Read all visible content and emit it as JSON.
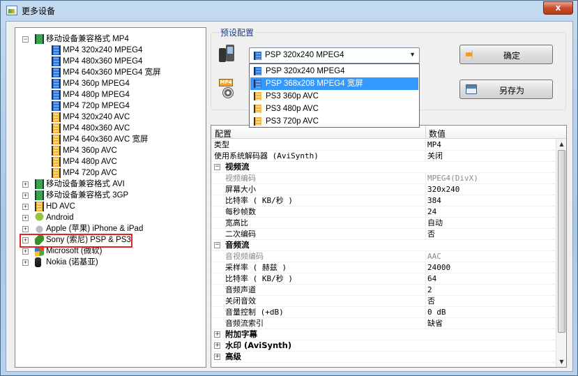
{
  "window": {
    "title": "更多设备",
    "close_label": "x"
  },
  "tree": {
    "items": [
      {
        "label": "移动设备兼容格式 MP4",
        "level": 0,
        "expander": "−",
        "icon": "film-green-icon"
      },
      {
        "label": "MP4 320x240 MPEG4",
        "level": 1,
        "icon": "film-blue-icon"
      },
      {
        "label": "MP4 480x360 MPEG4",
        "level": 1,
        "icon": "film-blue-icon"
      },
      {
        "label": "MP4 640x360 MPEG4 宽屏",
        "level": 1,
        "icon": "film-blue-icon"
      },
      {
        "label": "MP4 360p MPEG4",
        "level": 1,
        "icon": "film-blue-icon"
      },
      {
        "label": "MP4 480p MPEG4",
        "level": 1,
        "icon": "film-blue-icon"
      },
      {
        "label": "MP4 720p MPEG4",
        "level": 1,
        "icon": "film-blue-icon"
      },
      {
        "label": "MP4 320x240 AVC",
        "level": 1,
        "icon": "film-orange-icon"
      },
      {
        "label": "MP4 480x360 AVC",
        "level": 1,
        "icon": "film-orange-icon"
      },
      {
        "label": "MP4 640x360 AVC 宽屏",
        "level": 1,
        "icon": "film-orange-icon"
      },
      {
        "label": "MP4 360p AVC",
        "level": 1,
        "icon": "film-orange-icon"
      },
      {
        "label": "MP4 480p AVC",
        "level": 1,
        "icon": "film-orange-icon"
      },
      {
        "label": "MP4 720p AVC",
        "level": 1,
        "icon": "film-orange-icon"
      },
      {
        "label": "移动设备兼容格式 AVI",
        "level": 0,
        "expander": "+",
        "icon": "film-green-icon"
      },
      {
        "label": "移动设备兼容格式 3GP",
        "level": 0,
        "expander": "+",
        "icon": "film-green-icon"
      },
      {
        "label": "HD AVC",
        "level": 0,
        "expander": "+",
        "icon": "film-orange-icon"
      },
      {
        "label": "Android",
        "level": 0,
        "expander": "+",
        "icon": "android-icon"
      },
      {
        "label": "Apple (苹果) iPhone & iPad",
        "level": 0,
        "expander": "+",
        "icon": "apple-icon"
      },
      {
        "label": "Sony (索尼) PSP & PS3",
        "level": 0,
        "expander": "+",
        "icon": "sony-psp-icon"
      },
      {
        "label": "Microsoft (微软)",
        "level": 0,
        "expander": "+",
        "icon": "microsoft-icon"
      },
      {
        "label": "Nokia (诺基亚)",
        "level": 0,
        "expander": "+",
        "icon": "nokia-phone-icon"
      }
    ]
  },
  "preset": {
    "group_title": "预设配置",
    "selected": "PSP 320x240 MPEG4",
    "options": [
      {
        "label": "PSP 320x240 MPEG4",
        "icon": "film-blue-icon",
        "selected": false
      },
      {
        "label": "PSP 368x208 MPEG4 宽屏",
        "icon": "film-blue-icon",
        "selected": true
      },
      {
        "label": "PS3 360p AVC",
        "icon": "film-orange-icon",
        "selected": false
      },
      {
        "label": "PS3 480p AVC",
        "icon": "film-orange-icon",
        "selected": false
      },
      {
        "label": "PS3 720p AVC",
        "icon": "film-orange-icon",
        "selected": false
      }
    ],
    "ok_label": "确定",
    "save_as_label": "另存为",
    "mp4_badge": "MP4"
  },
  "grid": {
    "col_name": "配置",
    "col_value": "数值",
    "rows": [
      {
        "kind": "prop",
        "name": "类型",
        "value": "MP4"
      },
      {
        "kind": "prop",
        "name": "使用系统解码器 (AviSynth)",
        "value": "关闭"
      },
      {
        "kind": "cat",
        "name": "视频流",
        "exp": "−"
      },
      {
        "kind": "prop",
        "name": "视频编码",
        "value": "MPEG4(DivX)",
        "disabled": true,
        "indent": true
      },
      {
        "kind": "prop",
        "name": "屏幕大小",
        "value": "320x240",
        "indent": true
      },
      {
        "kind": "prop",
        "name": "比特率 ( KB/秒 )",
        "value": "384",
        "indent": true
      },
      {
        "kind": "prop",
        "name": "每秒帧数",
        "value": "24",
        "indent": true
      },
      {
        "kind": "prop",
        "name": "宽高比",
        "value": "自动",
        "indent": true
      },
      {
        "kind": "prop",
        "name": "二次编码",
        "value": "否",
        "indent": true
      },
      {
        "kind": "cat",
        "name": "音频流",
        "exp": "−"
      },
      {
        "kind": "prop",
        "name": "音视频编码",
        "value": "AAC",
        "disabled": true,
        "indent": true
      },
      {
        "kind": "prop",
        "name": "采样率 ( 赫兹 )",
        "value": "24000",
        "indent": true
      },
      {
        "kind": "prop",
        "name": "比特率 ( KB/秒 )",
        "value": "64",
        "indent": true
      },
      {
        "kind": "prop",
        "name": "音频声道",
        "value": "2",
        "indent": true
      },
      {
        "kind": "prop",
        "name": "关闭音效",
        "value": "否",
        "indent": true
      },
      {
        "kind": "prop",
        "name": "音量控制 (+dB)",
        "value": "0 dB",
        "indent": true
      },
      {
        "kind": "prop",
        "name": "音频流索引",
        "value": "缺省",
        "indent": true
      },
      {
        "kind": "cat",
        "name": "附加字幕",
        "exp": "+"
      },
      {
        "kind": "cat",
        "name": "水印 (AviSynth)",
        "exp": "+"
      },
      {
        "kind": "cat",
        "name": "高级",
        "exp": "+"
      }
    ]
  }
}
